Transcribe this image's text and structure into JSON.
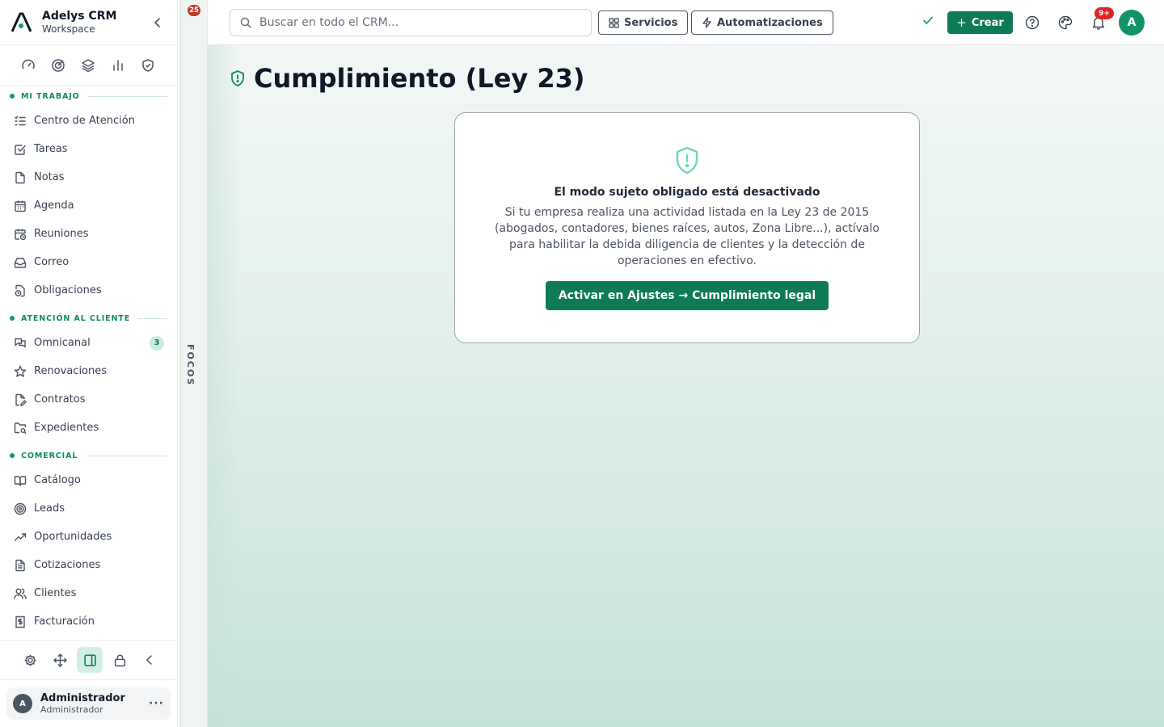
{
  "brand": {
    "name": "Adelys CRM",
    "subtitle": "Workspace"
  },
  "quick_icons": [
    "gauge-icon",
    "target-chart-icon",
    "layers-icon",
    "bar-chart-icon",
    "shield-check-icon"
  ],
  "sections": {
    "mi_trabajo": {
      "title": "MI TRABAJO",
      "items": [
        {
          "label": "Centro de Atención",
          "icon": "list-check-icon"
        },
        {
          "label": "Tareas",
          "icon": "square-check-icon"
        },
        {
          "label": "Notas",
          "icon": "file-icon"
        },
        {
          "label": "Agenda",
          "icon": "calendar-icon"
        },
        {
          "label": "Reuniones",
          "icon": "calendar-clock-icon"
        },
        {
          "label": "Correo",
          "icon": "inbox-icon"
        },
        {
          "label": "Obligaciones",
          "icon": "file-clock-icon"
        }
      ]
    },
    "atencion": {
      "title": "ATENCIÓN AL CLIENTE",
      "items": [
        {
          "label": "Omnicanal",
          "icon": "chat-icon",
          "badge": "3"
        },
        {
          "label": "Renovaciones",
          "icon": "star-icon"
        },
        {
          "label": "Contratos",
          "icon": "file-signature-icon"
        },
        {
          "label": "Expedientes",
          "icon": "folder-search-icon"
        }
      ]
    },
    "comercial": {
      "title": "COMERCIAL",
      "items": [
        {
          "label": "Catálogo",
          "icon": "book-open-icon"
        },
        {
          "label": "Leads",
          "icon": "target-icon"
        },
        {
          "label": "Oportunidades",
          "icon": "trending-up-icon"
        },
        {
          "label": "Cotizaciones",
          "icon": "file-text-icon"
        },
        {
          "label": "Clientes",
          "icon": "users-icon"
        },
        {
          "label": "Facturación",
          "icon": "receipt-dollar-icon"
        }
      ]
    }
  },
  "bottom_tools": [
    "gear-icon",
    "move-icon",
    "panel-icon",
    "lock-icon",
    "chevron-left-icon"
  ],
  "user": {
    "initial": "A",
    "name": "Administrador",
    "role": "Administrador",
    "more": "···"
  },
  "focos": {
    "label": "FOCOS",
    "badge": "25"
  },
  "topbar": {
    "search_placeholder": "Buscar en todo el CRM...",
    "servicios": "Servicios",
    "automatizaciones": "Automatizaciones",
    "crear": "Crear",
    "notif_badge": "9+",
    "avatar": "A"
  },
  "page": {
    "title": "Cumplimiento (Ley 23)",
    "card_title": "El modo sujeto obligado está desactivado",
    "card_body": "Si tu empresa realiza una actividad listada en la Ley 23 de 2015 (abogados, contadores, bienes raíces, autos, Zona Libre...), actívalo para habilitar la debida diligencia de clientes y la detección de operaciones en efectivo.",
    "card_button": "Activar en Ajustes → Cumplimiento legal"
  },
  "colors": {
    "accent": "#0e7a56",
    "badge_red": "#dc2626",
    "icon_mint": "#6ed7b1"
  }
}
